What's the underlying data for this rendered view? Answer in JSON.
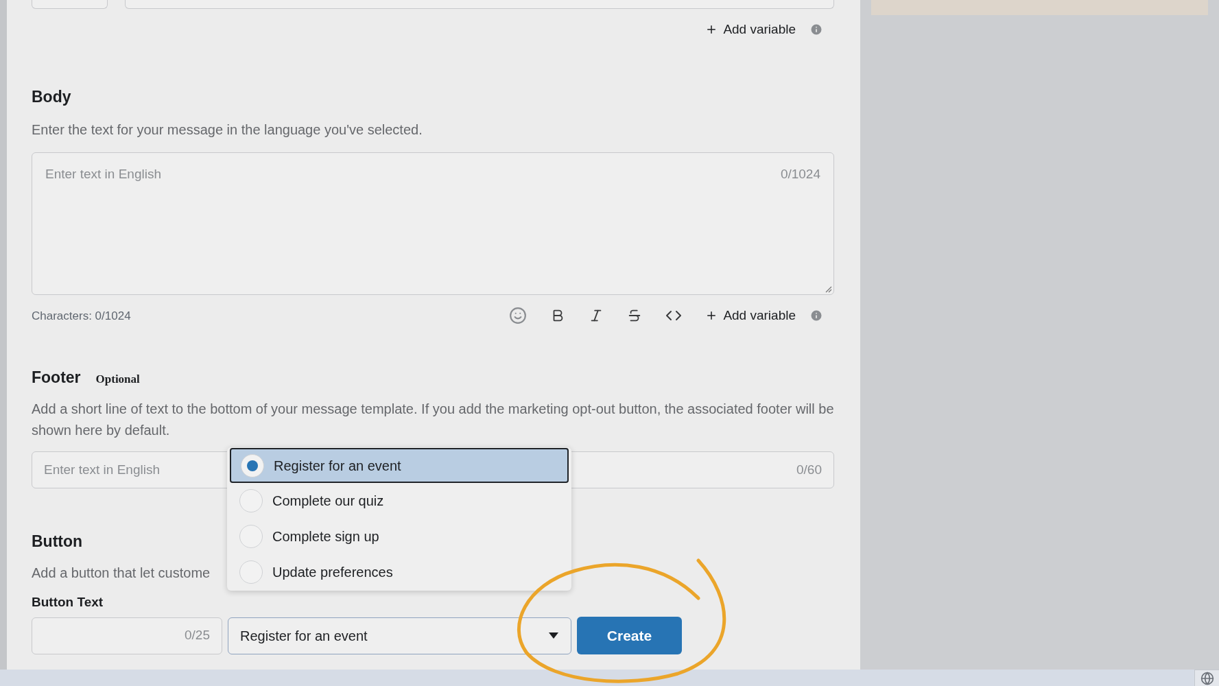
{
  "top_row": {
    "add_variable": "Add variable"
  },
  "body": {
    "title": "Body",
    "description": "Enter the text for your message in the language you've selected.",
    "placeholder": "Enter text in English",
    "counter": "0/1024",
    "characters": "Characters: 0/1024",
    "add_variable": "Add variable"
  },
  "footer": {
    "title": "Footer",
    "badge": "Optional",
    "description": "Add a short line of text to the bottom of your message template. If you add the marketing opt-out button, the associated footer will be shown here by default.",
    "placeholder": "Enter text in English",
    "counter": "0/60"
  },
  "button_section": {
    "title": "Button",
    "description": "Add a button that let custome",
    "button_text_label": "Button Text",
    "button_text_counter": "0/25",
    "form_type_value": "Register for an event",
    "create": "Create"
  },
  "menu_options": [
    {
      "label": "Register for an event",
      "selected": true
    },
    {
      "label": "Complete our quiz",
      "selected": false
    },
    {
      "label": "Complete sign up",
      "selected": false
    },
    {
      "label": "Update preferences",
      "selected": false
    }
  ]
}
